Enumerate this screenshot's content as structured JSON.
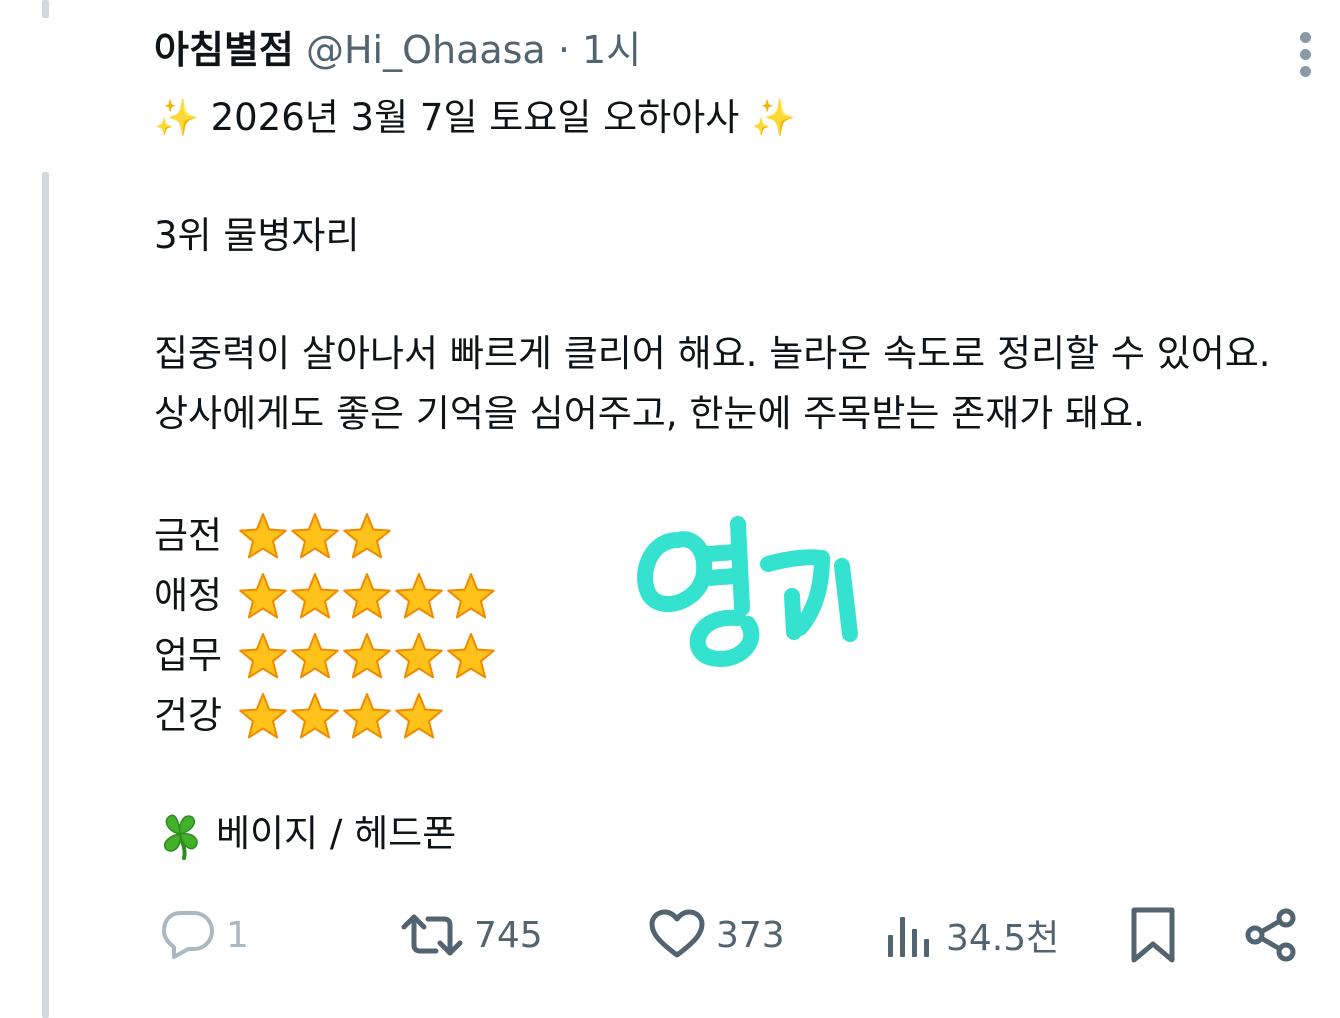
{
  "tweet": {
    "author_name": "아침별점",
    "author_handle": "@Hi_Ohaasa",
    "separator": "·",
    "time": "1시",
    "title_emoji": "✨",
    "title": "2026년 3월 7일 토요일 오하아사",
    "rank": "3위 물병자리",
    "body_lines": [
      "집중력이 살아나서 빠르게 클리어 해요. 놀라운 속도로 정리할 수 있어요.",
      "상사에게도 좋은 기억을 심어주고, 한눈에 주목받는 존재가 돼요."
    ],
    "ratings": [
      {
        "label": "금전",
        "stars": 3
      },
      {
        "label": "애정",
        "stars": 5
      },
      {
        "label": "업무",
        "stars": 5
      },
      {
        "label": "건강",
        "stars": 4
      }
    ],
    "lucky_icon": "four-leaf-clover",
    "lucky_items": "베이지 / 헤드폰",
    "doodle_text": "영규",
    "doodle_color": "#35e2cf"
  },
  "actions": {
    "reply_count": "1",
    "retweet_count": "745",
    "like_count": "373",
    "views_count": "34.5천"
  },
  "icons": {
    "more": "more-vertical-icon",
    "reply": "reply-icon",
    "retweet": "retweet-icon",
    "like": "heart-icon",
    "views": "views-bar-chart-icon",
    "bookmark": "bookmark-icon",
    "share": "share-icon"
  },
  "colors": {
    "text": "#0f1419",
    "muted": "#536471",
    "reply_faded": "#aab8c2",
    "thread_line": "#cfd9de",
    "star_fill": "#ffc21a",
    "star_outline": "#f08a00"
  }
}
